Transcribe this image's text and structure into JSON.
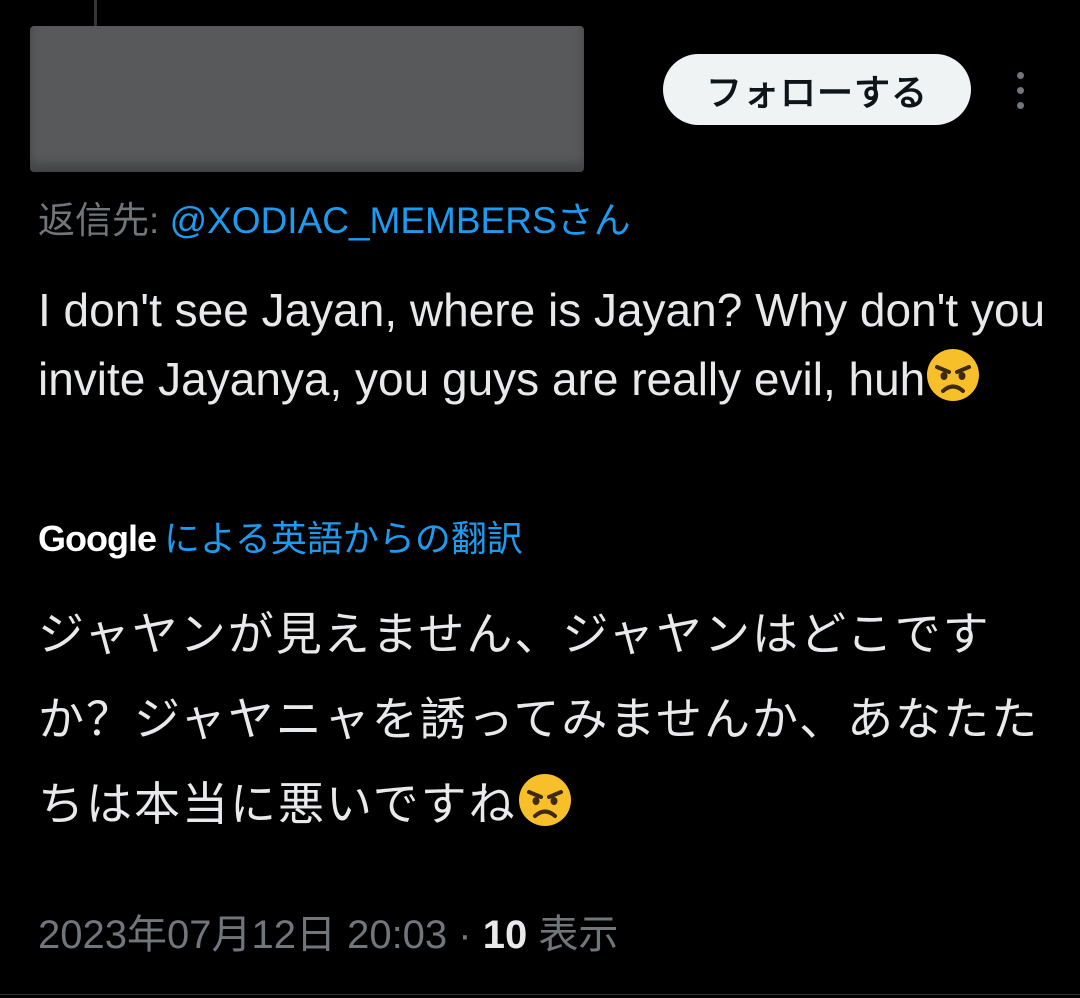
{
  "header": {
    "follow_label": "フォローする",
    "more_icon": "more-vertical-icon"
  },
  "reply": {
    "prefix": "返信先: ",
    "handle": "@XODIAC_MEMBERSさん"
  },
  "tweet": {
    "text": "I don't see Jayan, where is Jayan? Why don't you invite Jayanya, you guys are really evil, huh",
    "emoji": "angry-face-emoji"
  },
  "translation": {
    "brand": "Google",
    "label": "による英語からの翻訳",
    "text": "ジャヤンが見えません、ジャヤンはどこですか？ジャヤニャを誘ってみませんか、あなたたちは本当に悪いですね"
  },
  "meta": {
    "timestamp": "2023年07月12日 20:03",
    "separator": " · ",
    "views_count": "10",
    "views_label": " 表示"
  },
  "colors": {
    "background": "#000000",
    "text": "#e7e9ea",
    "secondary": "#71767b",
    "link": "#1d9bf0"
  }
}
